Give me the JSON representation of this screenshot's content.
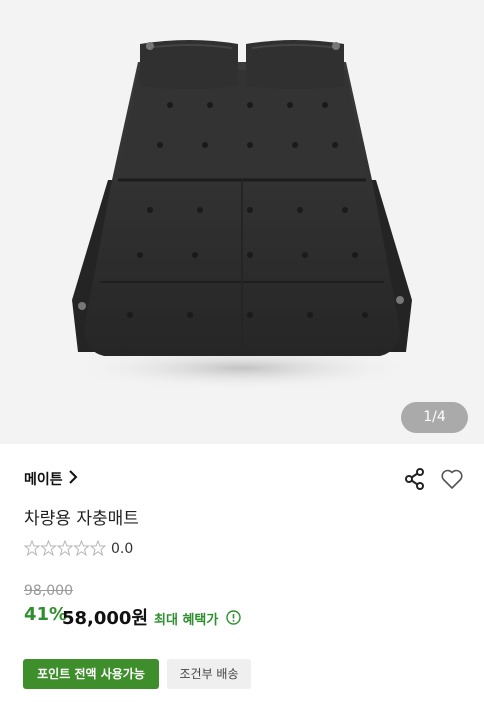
{
  "gallery": {
    "image_alt": "black inflatable car camping mattress",
    "counter": "1/4"
  },
  "product": {
    "brand": "메이튼",
    "title": "차량용 자충매트",
    "rating": "0.0",
    "stars_filled": 0,
    "stars_total": 5,
    "original_price": "98,000",
    "discount": "41%",
    "price": "58,000원",
    "benefit_label": "최대 혜택가"
  },
  "tags": {
    "points": "포인트 전액 사용가능",
    "shipping": "조건부 배송"
  },
  "colors": {
    "accent_green": "#2f8f2f",
    "tag_green": "#3e8e2c",
    "mattress": "#2b2b2b"
  },
  "icons": [
    "chevron-right-icon",
    "share-icon",
    "heart-icon",
    "star-icon",
    "info-icon"
  ]
}
